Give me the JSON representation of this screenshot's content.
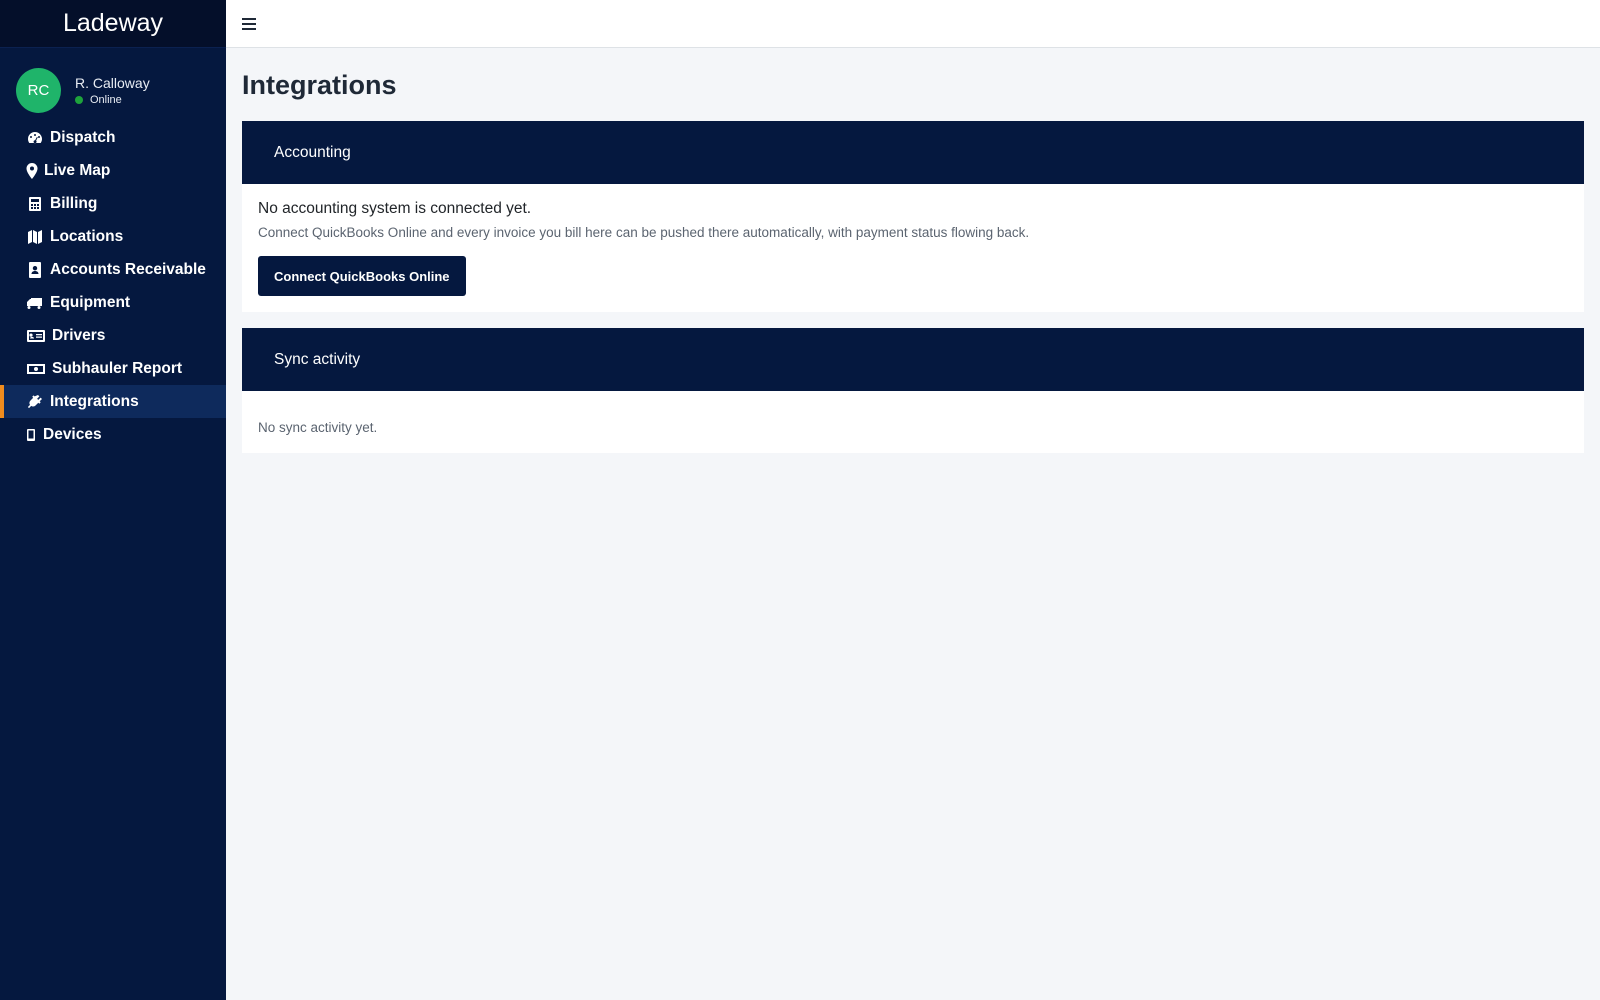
{
  "brand": "Ladeway",
  "user": {
    "initials": "RC",
    "name": "R. Calloway",
    "status": "Online"
  },
  "nav": [
    {
      "label": "Dispatch",
      "icon": "dashboard-icon"
    },
    {
      "label": "Live Map",
      "icon": "map-marker-icon"
    },
    {
      "label": "Billing",
      "icon": "calculator-icon"
    },
    {
      "label": "Locations",
      "icon": "map-icon"
    },
    {
      "label": "Accounts Receivable",
      "icon": "contact-book-icon"
    },
    {
      "label": "Equipment",
      "icon": "truck-icon"
    },
    {
      "label": "Drivers",
      "icon": "id-card-icon"
    },
    {
      "label": "Subhauler Report",
      "icon": "money-bill-icon"
    },
    {
      "label": "Integrations",
      "icon": "plug-icon",
      "active": true
    },
    {
      "label": "Devices",
      "icon": "mobile-icon"
    }
  ],
  "page": {
    "title": "Integrations"
  },
  "accounting": {
    "header": "Accounting",
    "headline": "No accounting system is connected yet.",
    "description": "Connect QuickBooks Online and every invoice you bill here can be pushed there automatically, with payment status flowing back.",
    "button": "Connect QuickBooks Online"
  },
  "sync": {
    "header": "Sync activity",
    "empty": "No sync activity yet."
  },
  "colors": {
    "sidebar": "#05183f",
    "accent": "#f08c1e",
    "avatar": "#1fb46a",
    "online": "#1ea33c"
  }
}
